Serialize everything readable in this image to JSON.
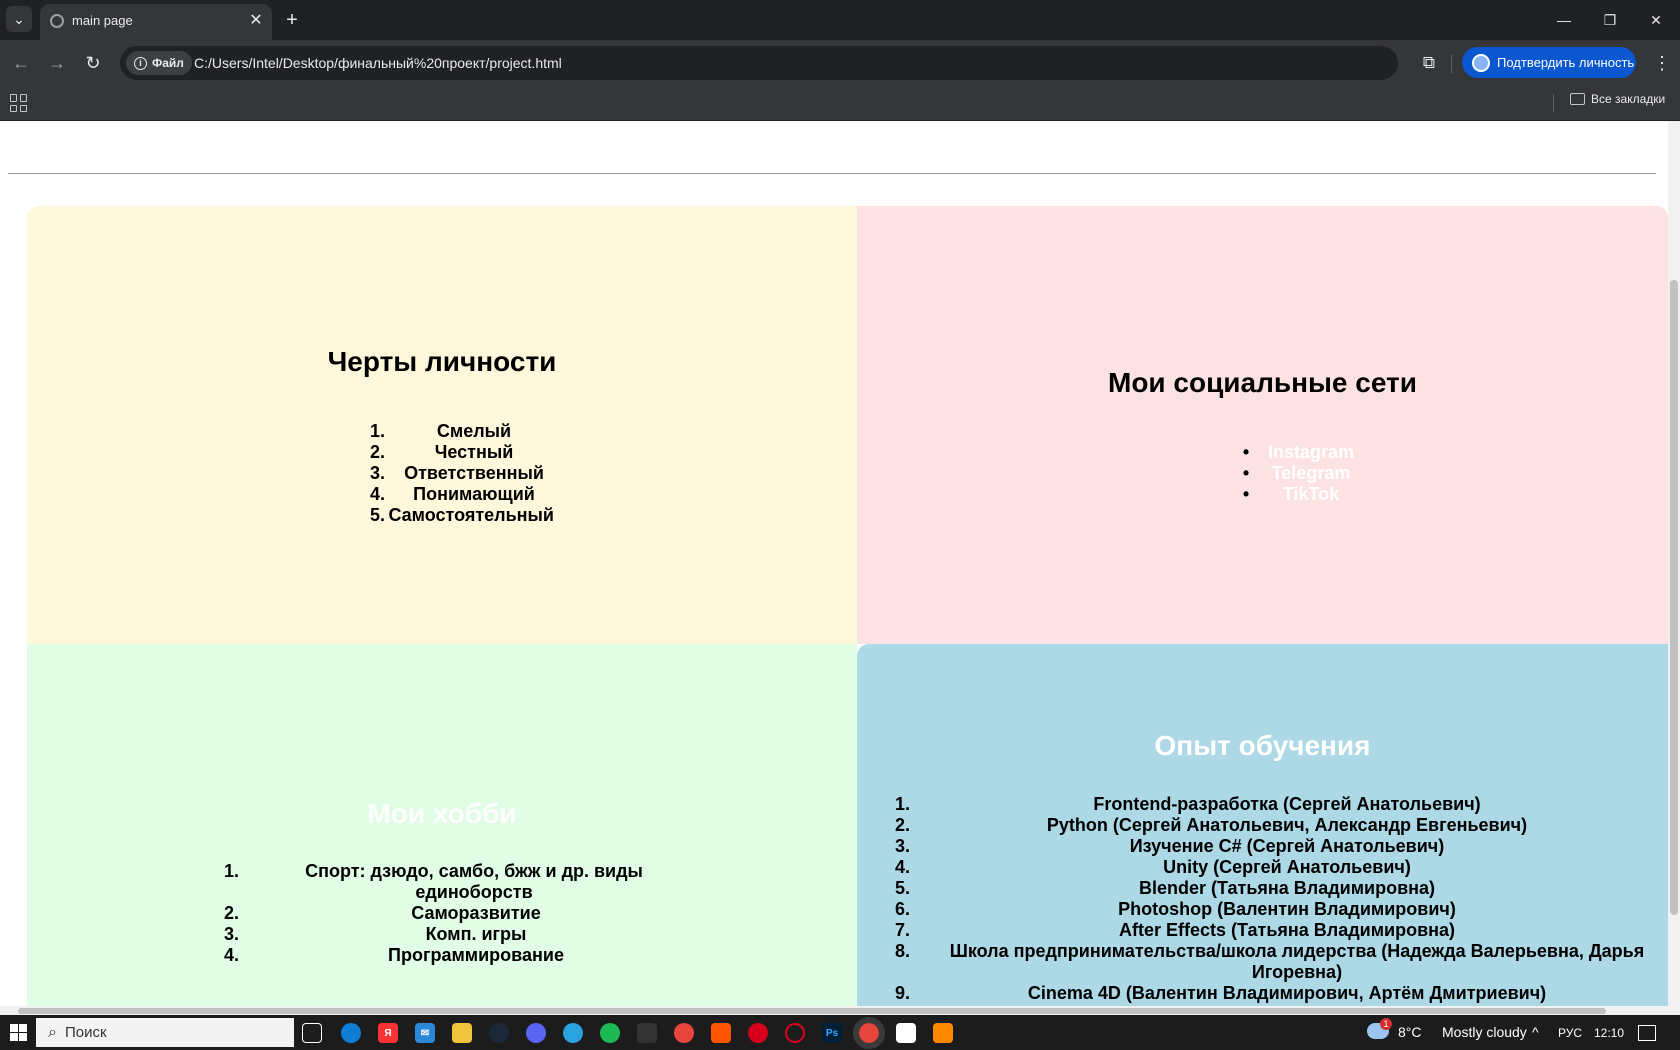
{
  "browser": {
    "tab_title": "main page",
    "file_label": "Файл",
    "url": "C:/Users/Intel/Desktop/финальный%20проект/project.html",
    "profile_button": "Подтвердить личность",
    "bookmarks_all": "Все закладки"
  },
  "page": {
    "traits": {
      "title": "Черты личности",
      "items": [
        "Смелый",
        "Честный",
        "Ответственный",
        "Понимающий",
        "Самостоятельный"
      ]
    },
    "social": {
      "title": "Мои социальные сети",
      "links": [
        "Instagram",
        "Telegram",
        "TikTok"
      ]
    },
    "hobbies": {
      "title": "Мои хобби",
      "items": [
        "Спорт: дзюдо, самбо, бжж и др. виды единоборств",
        "Саморазвитие",
        "Комп. игры",
        "Программирование"
      ]
    },
    "education": {
      "title": "Опыт обучения",
      "items": [
        "Frontend-разработка (Сергей Анатольевич)",
        "Python (Сергей Анатольевич, Александр Евгеньевич)",
        "Изучение C# (Сергей Анатольевич)",
        "Unity (Сергей Анатольевич)",
        "Blender (Татьяна Владимировна)",
        "Photoshop (Валентин Владимирович)",
        "After Effects (Татьяна Владимировна)",
        "Школа предпринимательства/школа лидерства (Надежда Валерьевна, Дарья Игоревна)",
        "Cinema 4D (Валентин Владимирович, Артём Дмитриевич)"
      ]
    }
  },
  "taskbar": {
    "search_placeholder": "Поиск",
    "weather_temp": "8°C",
    "weather_text": "Mostly cloudy",
    "language": "РУС",
    "time": "12:10",
    "weather_badge": "1"
  }
}
